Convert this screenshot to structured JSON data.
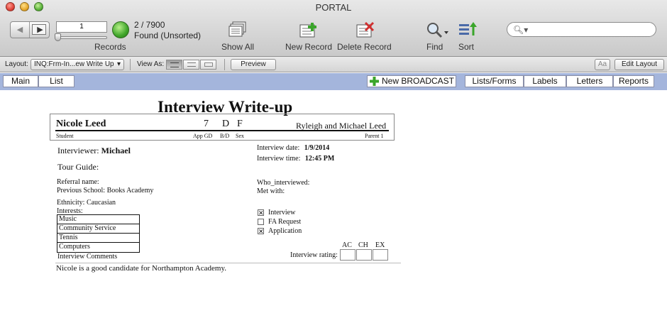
{
  "window": {
    "title": "PORTAL"
  },
  "toolbar": {
    "record_current": "1",
    "records_label": "Records",
    "count_text": "2 / 7900",
    "found_text": "Found (Unsorted)",
    "show_all_label": "Show All",
    "new_record_label": "New Record",
    "delete_record_label": "Delete Record",
    "find_label": "Find",
    "sort_label": "Sort",
    "search_placeholder": ""
  },
  "layoutbar": {
    "layout_label": "Layout:",
    "layout_value": "INQ:Frm-In...ew Write Up",
    "view_as_label": "View As:",
    "preview_label": "Preview",
    "aa_label": "Aa",
    "edit_layout_label": "Edit Layout"
  },
  "navbar": {
    "main_label": "Main",
    "list_label": "List",
    "new_broadcast_label": "New BROADCAST",
    "lists_forms_label": "Lists/Forms",
    "labels_label": "Labels",
    "letters_label": "Letters",
    "reports_label": "Reports"
  },
  "form": {
    "title": "Interview Write-up",
    "student_name": "Nicole Leed",
    "app_gd": "7",
    "bd": "D",
    "sex": "F",
    "parent_name": "Ryleigh and Michael Leed",
    "student_caption": "Student",
    "app_gd_caption": "App GD",
    "bd_caption": "B/D",
    "sex_caption": "Sex",
    "parent_caption": "Parent 1",
    "interviewer_label": "Interviewer:",
    "interviewer_value": "Michael",
    "tour_guide_label": "Tour Guide:",
    "referral_label": "Referral name:",
    "previous_school_label": "Previous School:",
    "previous_school_value": "Books Academy",
    "ethnicity_label": "Ethnicity:",
    "ethnicity_value": "Caucasian",
    "interests_label": "Interests:",
    "interests": [
      "Music",
      "Community Service",
      "Tennis",
      "Computers"
    ],
    "interview_comments_label": "Interview Comments",
    "comment": "Nicole is a good candidate for Northampton Academy.",
    "interview_date_label": "Interview date:",
    "interview_date_value": "1/9/2014",
    "interview_time_label": "Interview time:",
    "interview_time_value": "12:45 PM",
    "who_interviewed_label": "Who_interviewed:",
    "met_with_label": "Met with:",
    "checkboxes": [
      {
        "label": "Interview",
        "checked": true
      },
      {
        "label": "FA Request",
        "checked": false
      },
      {
        "label": "Application",
        "checked": true
      }
    ],
    "rating_label": "Interview rating:",
    "rating_headers": [
      "AC",
      "CH",
      "EX"
    ]
  }
}
